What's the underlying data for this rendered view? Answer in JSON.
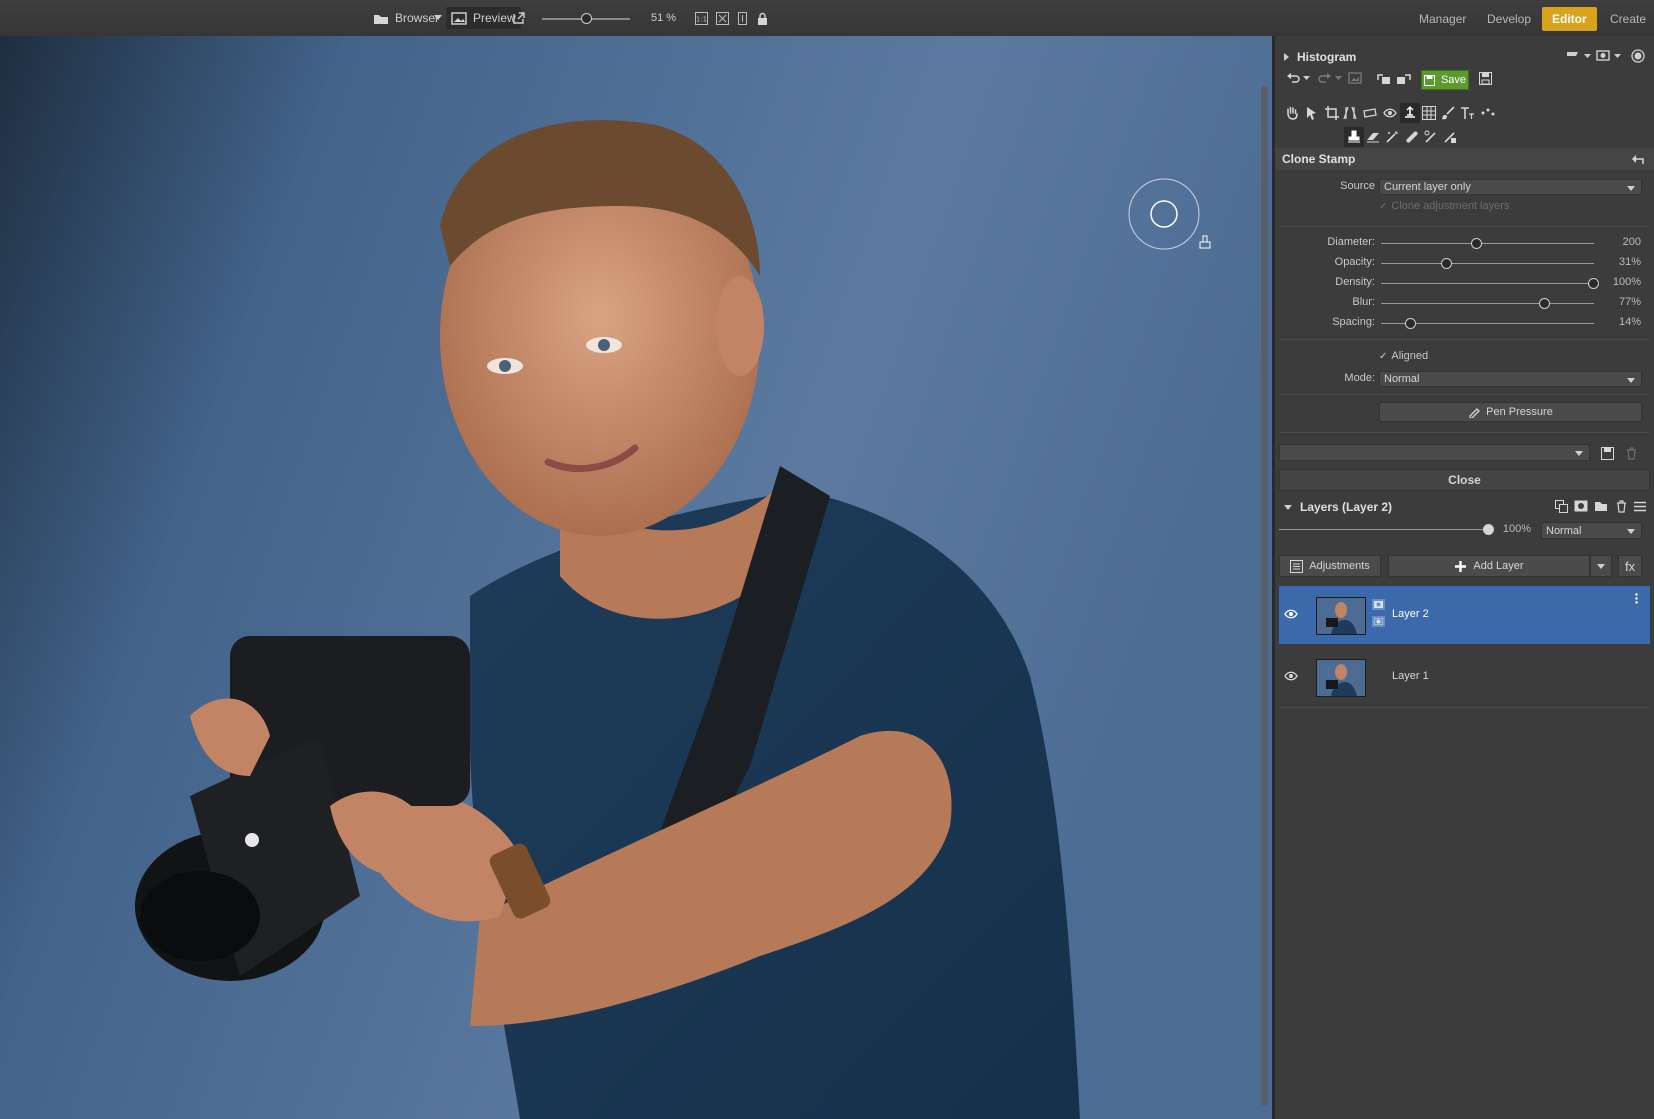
{
  "topbar": {
    "browser_label": "Browser",
    "preview_label": "Preview",
    "zoom": "51 %",
    "zoom_level": 0.51,
    "tabs": [
      "Manager",
      "Develop",
      "Editor",
      "Create"
    ],
    "active_tab": "Editor"
  },
  "histogram": {
    "title": "Histogram"
  },
  "toolbar": {
    "save_label": "Save"
  },
  "clone_stamp": {
    "title": "Clone Stamp",
    "source_label": "Source",
    "source_value": "Current layer only",
    "clone_adjustment_label": "Clone adjustment layers",
    "sliders": [
      {
        "label": "Diameter:",
        "value": "200",
        "fraction": 0.45
      },
      {
        "label": "Opacity:",
        "value": "31%",
        "fraction": 0.31
      },
      {
        "label": "Density:",
        "value": "100%",
        "fraction": 1.0
      },
      {
        "label": "Blur:",
        "value": "77%",
        "fraction": 0.77
      },
      {
        "label": "Spacing:",
        "value": "14%",
        "fraction": 0.14
      }
    ],
    "aligned_label": "Aligned",
    "mode_label": "Mode:",
    "mode_value": "Normal",
    "pen_pressure_label": "Pen Pressure",
    "close_label": "Close"
  },
  "layers": {
    "title": "Layers (Layer 2)",
    "opacity": "100%",
    "opacity_fraction": 1.0,
    "blend_mode": "Normal",
    "adjustments_label": "Adjustments",
    "add_layer_label": "Add Layer",
    "fx_label": "fx",
    "items": [
      {
        "name": "Layer 2",
        "selected": true
      },
      {
        "name": "Layer 1",
        "selected": false
      }
    ]
  },
  "colors": {
    "accent": "#d9a21b",
    "selected_layer": "#3b69ac",
    "save_green": "#5d9a2e",
    "backdrop_blue": "#3f5c7d"
  }
}
